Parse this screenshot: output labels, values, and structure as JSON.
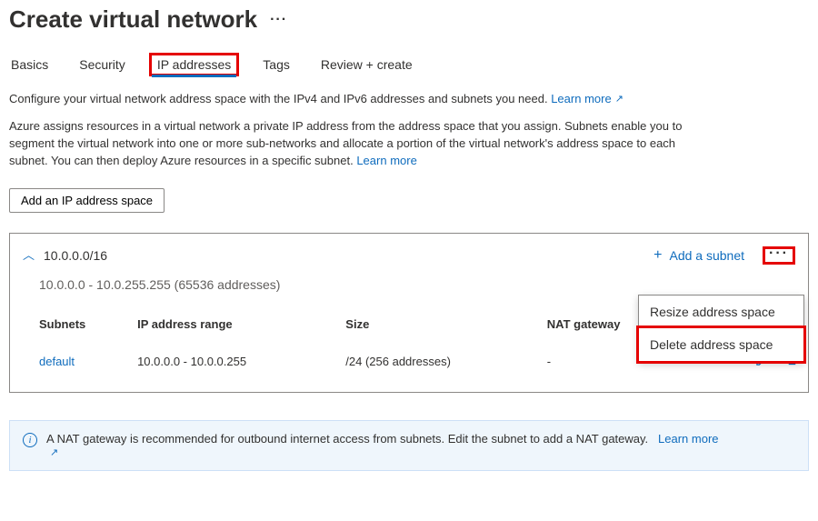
{
  "header": {
    "title": "Create virtual network"
  },
  "tabs": {
    "basics": "Basics",
    "security": "Security",
    "ip": "IP addresses",
    "tags": "Tags",
    "review": "Review + create",
    "active": "ip"
  },
  "intro": {
    "line1_text": "Configure your virtual network address space with the IPv4 and IPv6 addresses and subnets you need.",
    "line1_link": "Learn more",
    "line2_text": "Azure assigns resources in a virtual network a private IP address from the address space that you assign. Subnets enable you to segment the virtual network into one or more sub-networks and allocate a portion of the virtual network's address space to each subnet. You can then deploy Azure resources in a specific subnet.",
    "line2_link": "Learn more"
  },
  "buttons": {
    "add_space": "Add an IP address space",
    "add_subnet": "Add a subnet"
  },
  "address_space": {
    "cidr": "10.0.0.0/16",
    "detail": "10.0.0.0 - 10.0.255.255 (65536 addresses)"
  },
  "subnets_table": {
    "headers": [
      "Subnets",
      "IP address range",
      "Size",
      "NAT gateway"
    ],
    "rows": [
      {
        "name": "default",
        "range": "10.0.0.0 - 10.0.0.255",
        "size": "/24 (256 addresses)",
        "nat": "-"
      }
    ]
  },
  "context_menu": {
    "resize": "Resize address space",
    "delete": "Delete address space"
  },
  "info": {
    "text": "A NAT gateway is recommended for outbound internet access from subnets. Edit the subnet to add a NAT gateway.",
    "link": "Learn more"
  }
}
